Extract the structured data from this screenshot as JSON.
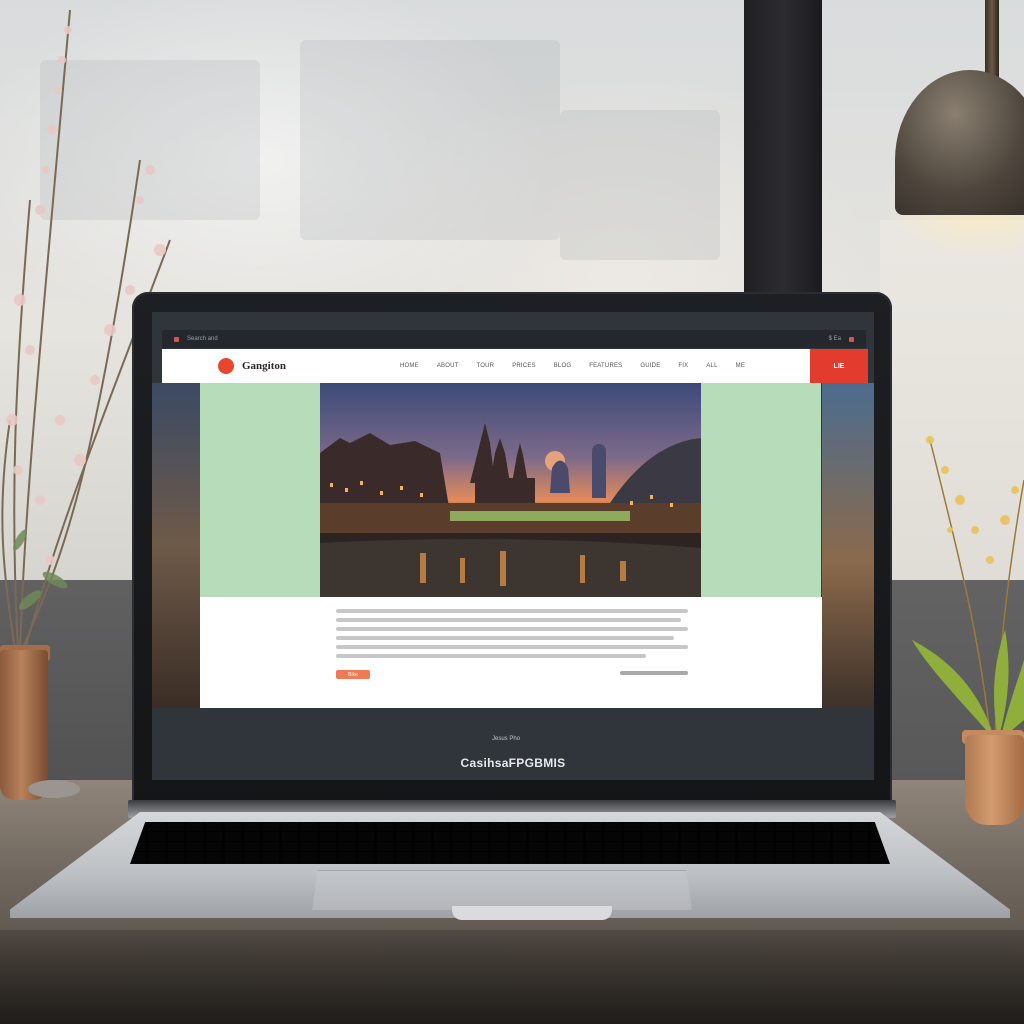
{
  "scene": {
    "description_colors": {
      "accent_red": "#e33b2e",
      "logo_orange": "#e8472d",
      "panel_green": "#b7dcb9",
      "button_orange": "#ef7a55"
    }
  },
  "website": {
    "logo": {
      "text": "Gangiton",
      "icon": "flame-logo-icon"
    },
    "topbar": {
      "left_text": "Search and",
      "right_text": "$ Ea"
    },
    "nav": [
      "HOME",
      "ABOUT",
      "TOUR",
      "PRICES",
      "BLOG",
      "FEATURES",
      "GUIDE",
      "FIX",
      "ALL",
      "ME"
    ],
    "cta_label": "LIE",
    "card_button_label": "Bike",
    "footer_badge": "Jesus Pho",
    "footer_title": "CasihsaFPGBMIS"
  }
}
